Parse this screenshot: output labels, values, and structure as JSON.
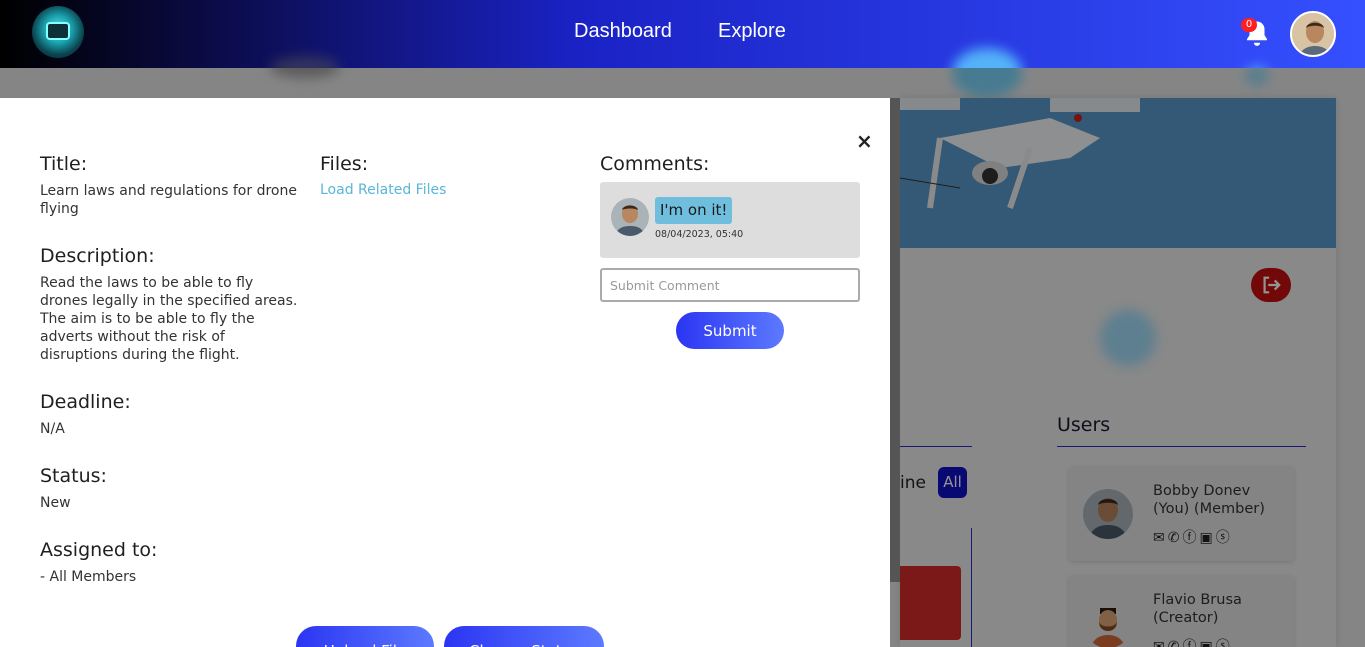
{
  "nav": {
    "dashboard": "Dashboard",
    "explore": "Explore",
    "notification_count": "0"
  },
  "background": {
    "users_title": "Users",
    "filter_partial": "ine",
    "filter_all": "All",
    "users": [
      {
        "name": "Bobby Donev (You) (Member)"
      },
      {
        "name": "Flavio Brusa (Creator)"
      }
    ],
    "social_icons": [
      "envelope-icon",
      "phone-icon",
      "facebook-icon",
      "linkedin-icon",
      "skype-icon"
    ]
  },
  "modal": {
    "title_label": "Title:",
    "title_value": "Learn laws and regulations for drone flying",
    "description_label": "Description:",
    "description_value": "Read the laws to be able to fly drones legally in the specified areas. The aim is to be able to fly the adverts without the risk of disruptions during the flight.",
    "deadline_label": "Deadline:",
    "deadline_value": "N/A",
    "status_label": "Status:",
    "status_value": "New",
    "assigned_label": "Assigned to:",
    "assigned_value": "- All Members",
    "files_label": "Files:",
    "files_link": "Load Related Files",
    "comments_label": "Comments:",
    "comments": [
      {
        "text": "I'm on it!",
        "time": "08/04/2023, 05:40"
      }
    ],
    "comment_placeholder": "Submit Comment",
    "submit_label": "Submit",
    "upload_label": "Upload File",
    "change_status_label": "Change Status",
    "close_symbol": "×"
  },
  "colors": {
    "accent": "#2b35f2",
    "link": "#59b5d9",
    "bubble": "#6fbedd",
    "danger": "#c40e0e"
  }
}
